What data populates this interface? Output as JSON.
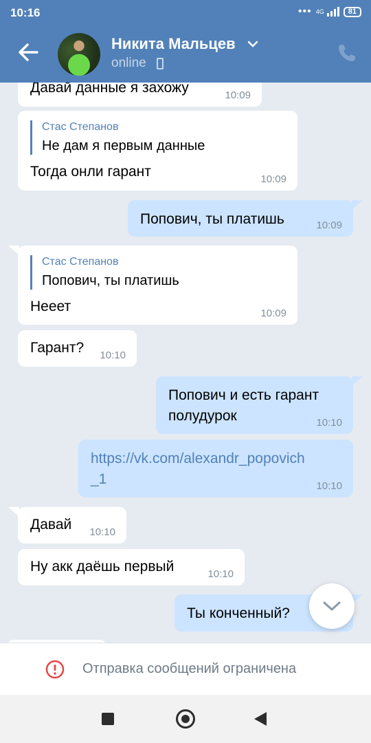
{
  "status_bar": {
    "time": "10:16",
    "dots": "•••",
    "network": "4G",
    "battery": "81"
  },
  "header": {
    "contact_name": "Никита Мальцев",
    "status": "online"
  },
  "messages": [
    {
      "id": 0,
      "direction": "in",
      "text": "Давай данные я захожу",
      "time": "10:09"
    },
    {
      "id": 1,
      "direction": "in",
      "reply_name": "Стас Степанов",
      "reply_text": "Не дам я первым данные",
      "text": "Тогда онли гарант",
      "time": "10:09"
    },
    {
      "id": 2,
      "direction": "out",
      "text": "Попович, ты платишь",
      "time": "10:09"
    },
    {
      "id": 3,
      "direction": "in",
      "reply_name": "Стас Степанов",
      "reply_text": "Попович, ты платишь",
      "text": "Нееет",
      "time": "10:09"
    },
    {
      "id": 4,
      "direction": "in",
      "text": "Гарант?",
      "time": "10:10"
    },
    {
      "id": 5,
      "direction": "out",
      "line1": "Попович и есть гарант",
      "line2": "полудурок",
      "time": "10:10"
    },
    {
      "id": 6,
      "direction": "out",
      "line1": "https://vk.com/alexandr_popovich",
      "line2": "_1",
      "time": "10:10"
    },
    {
      "id": 7,
      "direction": "in",
      "text": "Давай",
      "time": "10:10"
    },
    {
      "id": 8,
      "direction": "in",
      "text": "Ну акк даёшь первый",
      "time": "10:10"
    },
    {
      "id": 9,
      "direction": "out",
      "text": "Ты конченный?"
    }
  ],
  "restriction": {
    "text": "Отправка сообщений ограничена",
    "icon": "alert-circle-icon",
    "icon_color": "#e64646"
  },
  "colors": {
    "header": "#5181b8",
    "background": "#e6ebf1",
    "outgoing": "#cce4ff",
    "incoming": "#ffffff"
  }
}
